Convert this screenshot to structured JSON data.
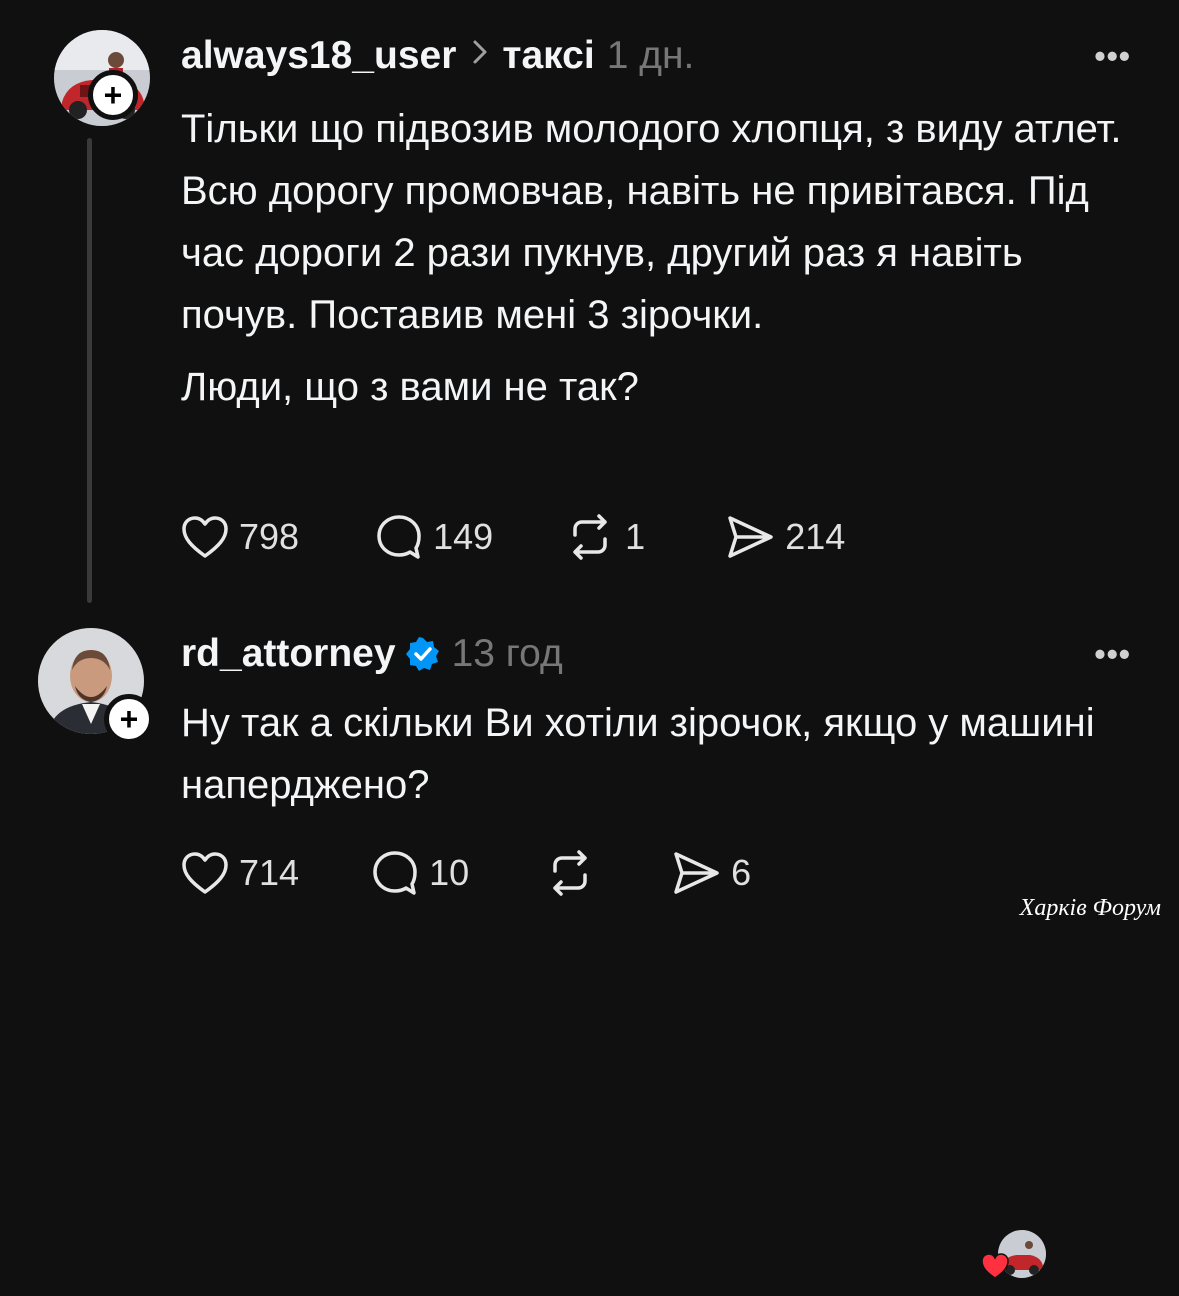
{
  "post": {
    "username": "always18_user",
    "topic": "таксі",
    "time": "1 дн.",
    "paragraph1": "Тільки що підвозив молодого хлопця, з виду атлет. Всю дорогу промовчав, навіть не привітався. Під час дороги 2 рази пукнув, другий раз я навіть почув. Поставив мені 3 зірочки.",
    "paragraph2": "Люди, що з вами не так?",
    "likes": "798",
    "comments": "149",
    "reposts": "1",
    "shares": "214"
  },
  "reply": {
    "username": "rd_attorney",
    "time": "13 год",
    "text": "Ну так а скільки Ви хотіли зірочок, якщо у машині наперджено?",
    "likes": "714",
    "comments": "10",
    "reposts": "",
    "shares": "6"
  },
  "icons": {
    "like": "heart-outline-icon",
    "comment": "speech-bubble-icon",
    "repost": "repost-arrows-icon",
    "share": "paper-plane-icon",
    "verified": "verified-badge-icon",
    "more": "more-dots-icon",
    "follow": "plus-icon"
  },
  "colors": {
    "background": "#101010",
    "text": "#f3f5f7",
    "muted": "#777777",
    "verified": "#0095f6",
    "like_heart": "#ff3040"
  },
  "more_label": "•••",
  "watermark": "Харків Форум"
}
